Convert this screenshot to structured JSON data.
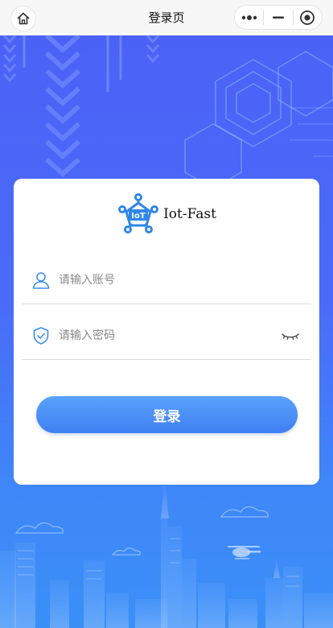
{
  "nav": {
    "title": "登录页"
  },
  "brand": {
    "logo_text": "IoT",
    "app_name": "Iot-Fast"
  },
  "form": {
    "account_placeholder": "请输入账号",
    "password_placeholder": "请输入密码",
    "submit_label": "登录"
  },
  "colors": {
    "accent": "#4a7ff5",
    "bg_top": "#4b62f7",
    "bg_bottom": "#3a8ff7",
    "icon_blue": "#3d8ef0"
  },
  "icons": {
    "home": "home-icon",
    "more": "more-dots-icon",
    "minimize": "minimize-icon",
    "close": "target-close-icon",
    "user": "user-icon",
    "shield": "shield-check-icon",
    "eye": "eye-closed-icon"
  }
}
